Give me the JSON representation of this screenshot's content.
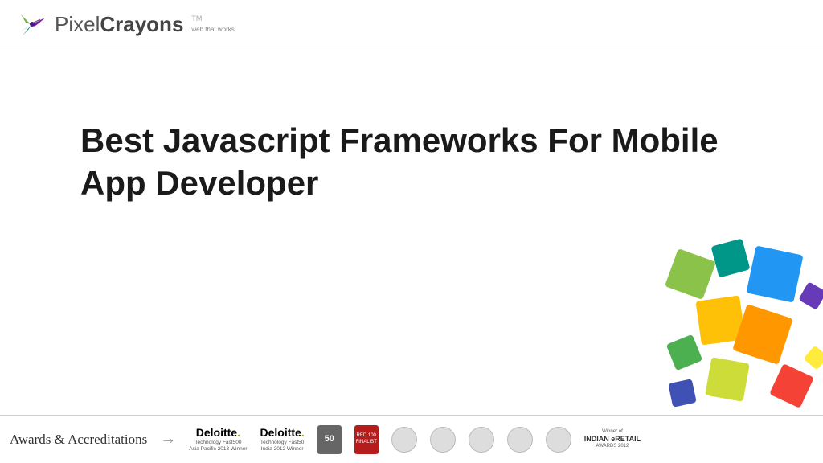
{
  "header": {
    "brand_first": "Pixel",
    "brand_second": "Crayons",
    "tagline": "web that works",
    "tm": "TM"
  },
  "main": {
    "title": "Best Javascript Frameworks For Mobile App Developer"
  },
  "footer": {
    "label": "Awards & Accreditations",
    "deloitte1": {
      "name": "Deloitte",
      "line1": "Technology Fast500",
      "line2": "Asia Pacific 2013 Winner"
    },
    "deloitte2": {
      "name": "Deloitte",
      "line1": "Technology Fast50",
      "line2": "India 2012 Winner"
    },
    "smartceo": "50",
    "red100": "RED 100 FINALIST",
    "indian_retail": {
      "prefix": "Winner of",
      "name": "INDIAN eRETAIL",
      "suffix": "AWARDS 2012"
    }
  },
  "colors": {
    "green": "#8bc34a",
    "blue": "#2196f3",
    "yellow": "#ffc107",
    "orange": "#ff9800",
    "teal": "#009688",
    "darkgreen": "#4caf50",
    "red": "#f44336",
    "navy": "#3f51b5"
  }
}
